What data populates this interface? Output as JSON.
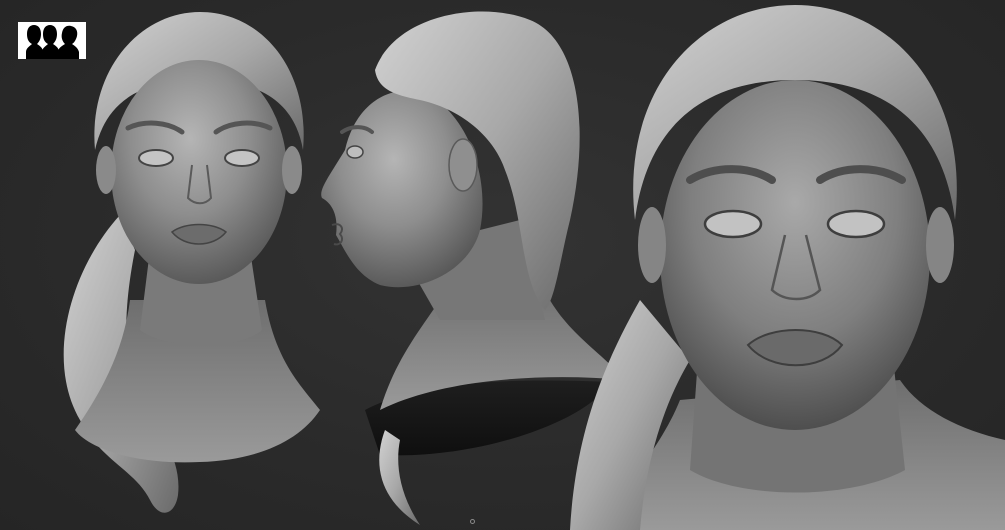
{
  "scene": {
    "background_color": "#2b2b2b",
    "clay_color": "#8c8c8c",
    "clay_highlight": "#c9c9c9",
    "clay_shadow": "#3e3e3e",
    "views": [
      {
        "name": "front-view"
      },
      {
        "name": "side-view"
      },
      {
        "name": "closeup-view"
      }
    ]
  },
  "logo": {
    "icon": "three-head-silhouettes-icon",
    "background": "#ffffff",
    "foreground": "#000000"
  },
  "pager": {
    "icon": "pager-dot-icon"
  }
}
